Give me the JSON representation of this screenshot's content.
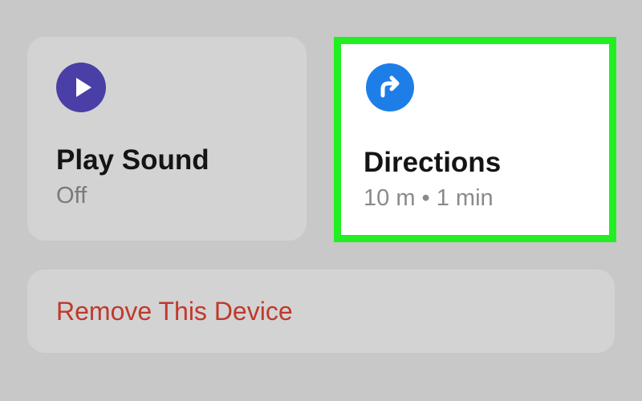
{
  "actions": {
    "play_sound": {
      "title": "Play Sound",
      "status": "Off",
      "icon": "play-icon",
      "icon_color": "#4a3fa6"
    },
    "directions": {
      "title": "Directions",
      "detail": "10 m • 1 min",
      "icon": "turn-right-arrow-icon",
      "icon_color": "#1e7ee8",
      "highlighted": true,
      "highlight_color": "#22ef22"
    }
  },
  "remove_device": {
    "label": "Remove This Device",
    "color": "#c0392b"
  }
}
